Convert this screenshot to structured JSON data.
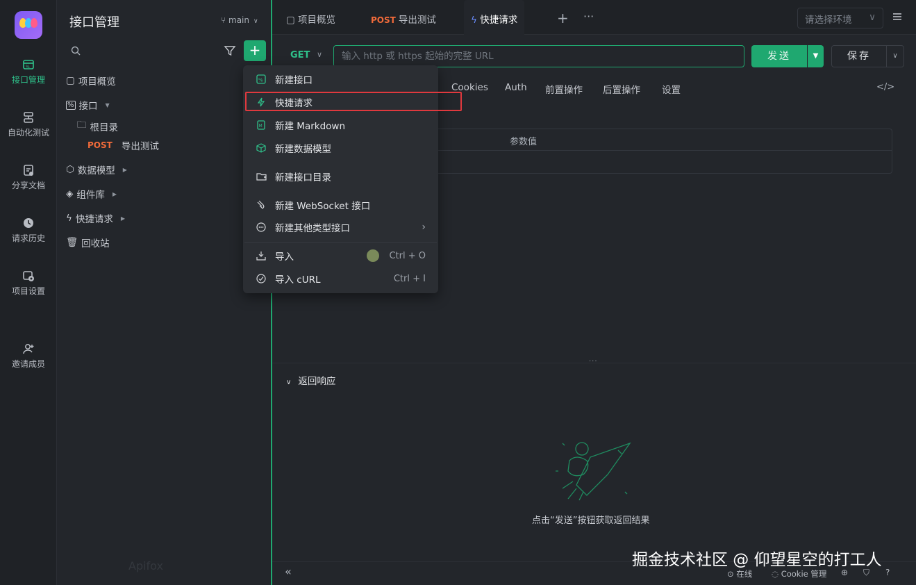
{
  "rail": {
    "items": [
      {
        "label": "接口管理",
        "icon": "api-icon",
        "active": true
      },
      {
        "label": "自动化测试",
        "icon": "automation-icon",
        "active": false
      },
      {
        "label": "分享文档",
        "icon": "share-doc-icon",
        "active": false
      },
      {
        "label": "请求历史",
        "icon": "history-icon",
        "active": false
      },
      {
        "label": "项目设置",
        "icon": "settings-icon",
        "active": false
      },
      {
        "label": "邀请成员",
        "icon": "invite-member-icon",
        "active": false
      }
    ]
  },
  "tree": {
    "title": "接口管理",
    "branch": "main",
    "items": {
      "overview": "项目概览",
      "apis": "接口",
      "root": "根目录",
      "post_method": "POST",
      "post_name": "导出测试",
      "models": "数据模型",
      "components": "组件库",
      "quick": "快捷请求",
      "trash": "回收站"
    },
    "watermark": "Apifox"
  },
  "tabs": {
    "overview": "项目概览",
    "post_method": "POST",
    "post_name": "导出测试",
    "quick": "快捷请求",
    "add": "+",
    "more": "···"
  },
  "env_select": {
    "placeholder": "请选择环境"
  },
  "request": {
    "method": "GET",
    "url_placeholder": "输入 http 或 https 起始的完整 URL",
    "url_value": "",
    "send": "发送",
    "save": "保存"
  },
  "req_tabs": [
    "Cookies",
    "Auth",
    "前置操作",
    "后置操作",
    "设置"
  ],
  "code_icon": "</>",
  "params": {
    "col_value": "参数值"
  },
  "response": {
    "title": "返回响应",
    "hint": "点击“发送”按钮获取返回结果"
  },
  "statusbar": {
    "collapse": "«",
    "online": "在线",
    "cookie": "Cookie 管理"
  },
  "watermark_text": "掘金技术社区 @ 仰望星空的打工人",
  "dropdown": {
    "items": [
      {
        "label": "新建接口",
        "icon": "api-icon"
      },
      {
        "label": "快捷请求",
        "icon": "lightning-icon"
      },
      {
        "label": "新建 Markdown",
        "icon": "markdown-icon"
      },
      {
        "label": "新建数据模型",
        "icon": "cube-icon"
      },
      {
        "label": "新建接口目录",
        "icon": "folder-add-icon"
      },
      {
        "label": "新建 WebSocket 接口",
        "icon": "websocket-icon"
      },
      {
        "label": "新建其他类型接口",
        "icon": "more-circle-icon"
      },
      {
        "label": "导入",
        "icon": "import-icon",
        "shortcut": "Ctrl + O"
      },
      {
        "label": "导入 cURL",
        "icon": "curl-icon",
        "shortcut": "Ctrl + I"
      }
    ]
  },
  "colors": {
    "accent": "#1fa870",
    "post": "#f26b3a",
    "highlight": "#e0393e"
  }
}
